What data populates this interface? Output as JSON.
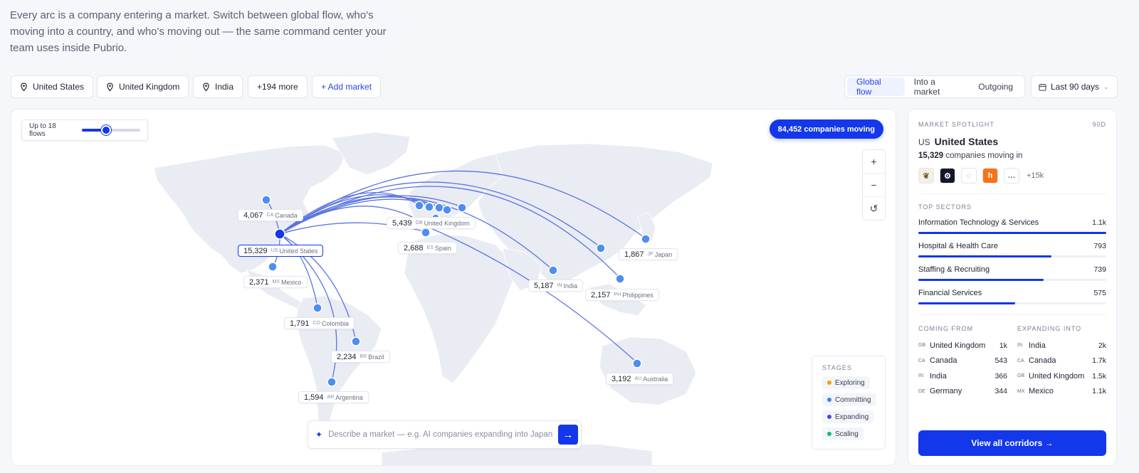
{
  "intro": "Every arc is a company entering a market. Switch between global flow, who's moving into a country, and who's moving out — the same command center your team uses inside Pubrio.",
  "markets": [
    {
      "label": "United States"
    },
    {
      "label": "United Kingdom"
    },
    {
      "label": "India"
    }
  ],
  "more_markets": "+194 more",
  "add_market": "+ Add market",
  "view_modes": [
    "Global flow",
    "Into a market",
    "Outgoing"
  ],
  "active_view": "Global flow",
  "date_range": "Last 90 days",
  "map": {
    "flows_label": "Up to 18 flows",
    "flows_level": 0.42,
    "companies_moving": "84,452 companies moving",
    "zoom_in": "+",
    "zoom_out": "−",
    "reset": "↺",
    "stages_title": "STAGES",
    "stages": [
      {
        "label": "Exploring",
        "color": "#f59e0b"
      },
      {
        "label": "Committing",
        "color": "#3b82f6"
      },
      {
        "label": "Expanding",
        "color": "#4f46e5"
      },
      {
        "label": "Scaling",
        "color": "#10b981"
      }
    ],
    "prompt_placeholder": "Describe a market — e.g. AI companies expanding into Japan",
    "prompt_go": "→",
    "market_labels": [
      {
        "value": "4,067",
        "code": "CA",
        "name": "Canada"
      },
      {
        "value": "15,329",
        "code": "US",
        "name": "United States"
      },
      {
        "value": "2,371",
        "code": "MX",
        "name": "Mexico"
      },
      {
        "value": "1,791",
        "code": "CO",
        "name": "Colombia"
      },
      {
        "value": "2,234",
        "code": "BR",
        "name": "Brazil"
      },
      {
        "value": "1,594",
        "code": "AR",
        "name": "Argentina"
      },
      {
        "value": "5,439",
        "code": "GB",
        "name": "United Kingdom"
      },
      {
        "value": "2,688",
        "code": "ES",
        "name": "Spain"
      },
      {
        "value": "5,187",
        "code": "IN",
        "name": "India"
      },
      {
        "value": "2,157",
        "code": "PH",
        "name": "Philippines"
      },
      {
        "value": "1,867",
        "code": "JP",
        "name": "Japan"
      },
      {
        "value": "3,192",
        "code": "AU",
        "name": "Australia"
      }
    ]
  },
  "spotlight": {
    "title": "MARKET SPOTLIGHT",
    "period": "90D",
    "country_code": "US",
    "country_name": "United States",
    "count": "15,329",
    "count_suffix": "companies moving in",
    "logos": [
      {
        "icon": "bird-logo-icon",
        "bg": "#f3f0e6",
        "fg": "#6b5a2a",
        "glyph": "❦"
      },
      {
        "icon": "gear-logo-icon",
        "bg": "#14162a",
        "fg": "#ffffff",
        "glyph": "⚙"
      },
      {
        "icon": "swirl-logo-icon",
        "bg": "#ffffff",
        "fg": "#f97316",
        "glyph": "◌"
      },
      {
        "icon": "h-logo-icon",
        "bg": "#f97316",
        "fg": "#ffffff",
        "glyph": "h"
      },
      {
        "icon": "wordmark-logo-icon",
        "bg": "#ffffff",
        "fg": "#6b7083",
        "glyph": "…"
      }
    ],
    "more_logos": "+15k",
    "sectors_title": "TOP SECTORS",
    "sectors": [
      {
        "name": "Information Technology & Services",
        "value": "1.1k",
        "share": 1.0
      },
      {
        "name": "Hospital & Health Care",
        "value": "793",
        "share": 0.71
      },
      {
        "name": "Staffing & Recruiting",
        "value": "739",
        "share": 0.665
      },
      {
        "name": "Financial Services",
        "value": "575",
        "share": 0.517
      }
    ],
    "coming_from_title": "COMING FROM",
    "coming_from": [
      {
        "code": "GB",
        "name": "United Kingdom",
        "value": "1k"
      },
      {
        "code": "CA",
        "name": "Canada",
        "value": "543"
      },
      {
        "code": "IN",
        "name": "India",
        "value": "366"
      },
      {
        "code": "DE",
        "name": "Germany",
        "value": "344"
      }
    ],
    "expanding_into_title": "EXPANDING INTO",
    "expanding_into": [
      {
        "code": "IN",
        "name": "India",
        "value": "2k"
      },
      {
        "code": "CA",
        "name": "Canada",
        "value": "1.7k"
      },
      {
        "code": "GB",
        "name": "United Kingdom",
        "value": "1.5k"
      },
      {
        "code": "MX",
        "name": "Mexico",
        "value": "1.1k"
      }
    ],
    "cta": "View all corridors →"
  },
  "colors": {
    "accent": "#1337ea",
    "arc": "#4a67e0",
    "marker": "#4f8df2",
    "land": "#e9ecf3"
  }
}
